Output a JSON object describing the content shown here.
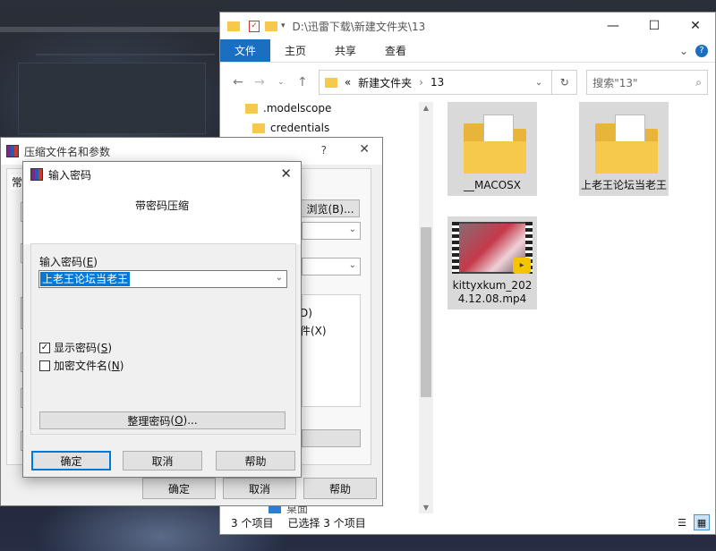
{
  "explorer": {
    "title_path": "D:\\迅雷下载\\新建文件夹\\13",
    "ribbon_tabs": [
      "文件",
      "主页",
      "共享",
      "查看"
    ],
    "address": [
      "新建文件夹",
      "13"
    ],
    "search_placeholder": "搜索\"13\"",
    "tree": [
      ".modelscope",
      "credentials",
      "桌面"
    ],
    "items": [
      "__MACOSX",
      "上老王论坛当老王",
      "kittyxkum_2024.12.08.mp4"
    ],
    "status_count": "3 个项目",
    "status_selected": "已选择 3 个项目"
  },
  "archive_dialog": {
    "title": "压缩文件名和参数",
    "tab_fragment": "常规",
    "browse_label": "浏览(B)...",
    "opt1_fragment": "D)",
    "opt2_fragment": "件(X)",
    "ok_label": "确定",
    "cancel_label": "取消",
    "help_label": "帮助"
  },
  "password_dialog": {
    "title": "输入密码",
    "heading": "带密码压缩",
    "field_label": "输入密码",
    "field_hotkey": "E",
    "password_value": "上老王论坛当老王",
    "show_password_label": "显示密码",
    "show_password_hotkey": "S",
    "show_password_checked": true,
    "encrypt_names_label": "加密文件名",
    "encrypt_names_hotkey": "N",
    "encrypt_names_checked": false,
    "organize_label": "整理密码",
    "organize_hotkey": "O",
    "ok_label": "确定",
    "cancel_label": "取消",
    "help_label": "帮助"
  },
  "colors": {
    "accent": "#0078d7",
    "ribbon_file": "#1a6fc0",
    "folder": "#f6c94d",
    "selection": "#d9d9d9"
  }
}
